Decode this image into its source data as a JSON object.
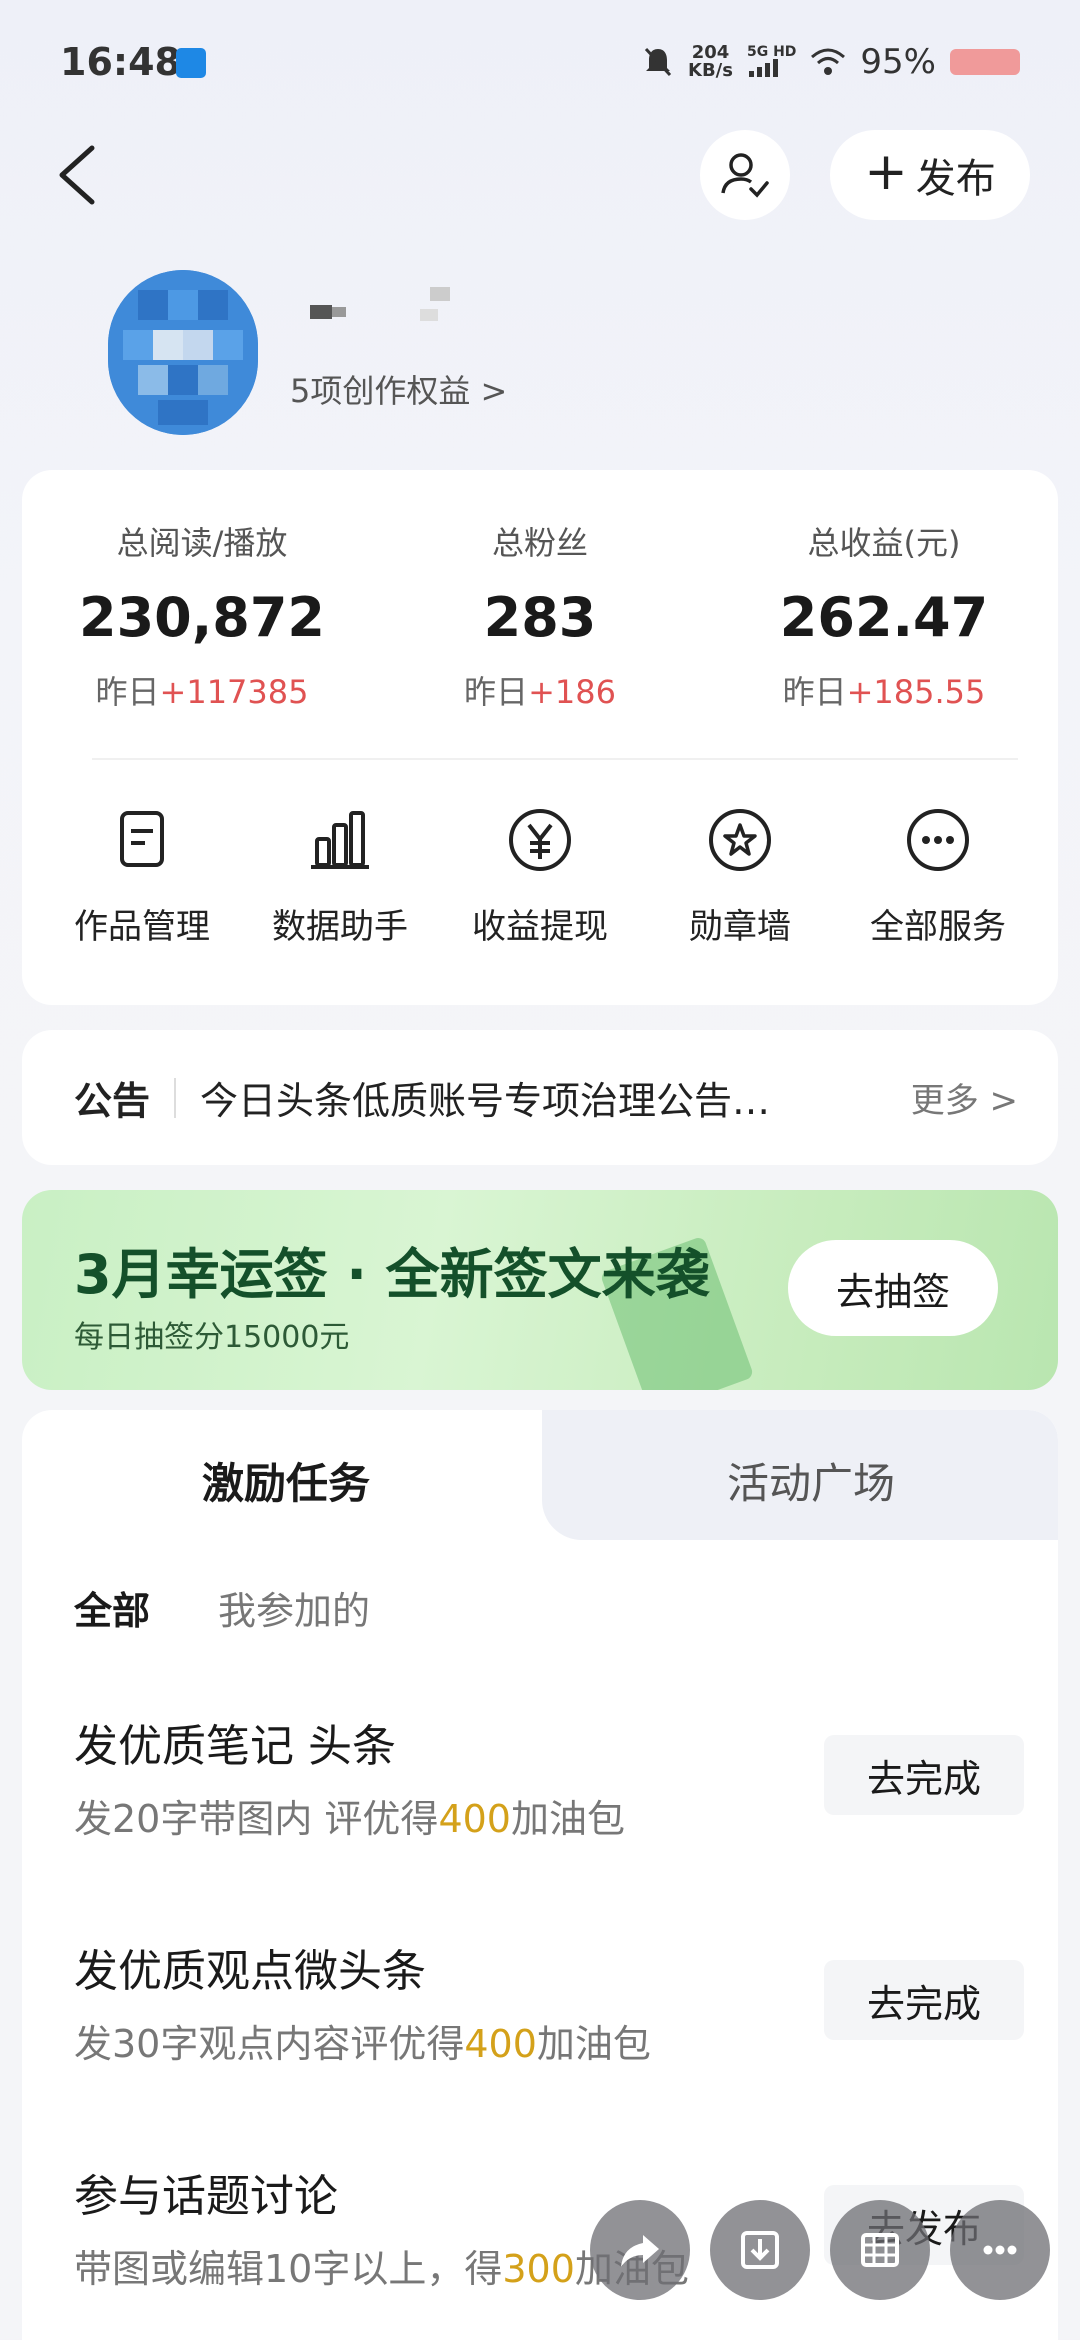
{
  "status_bar": {
    "time": "16:48",
    "net_speed_value": "204",
    "net_speed_unit": "KB/s",
    "network": "5G HD",
    "battery": "95%"
  },
  "header": {
    "publish_label": "发布",
    "follow_icon": "user-check-icon",
    "back_icon": "chevron-left-icon"
  },
  "profile": {
    "benefits_label": "5项创作权益 >"
  },
  "stats": [
    {
      "label": "总阅读/播放",
      "value": "230,872",
      "delta_prefix": "昨日",
      "delta": "+117385"
    },
    {
      "label": "总粉丝",
      "value": "283",
      "delta_prefix": "昨日",
      "delta": "+186"
    },
    {
      "label": "总收益(元)",
      "value": "262.47",
      "delta_prefix": "昨日",
      "delta": "+185.55"
    }
  ],
  "services": [
    {
      "label": "作品管理",
      "icon": "document-icon"
    },
    {
      "label": "数据助手",
      "icon": "bar-chart-icon"
    },
    {
      "label": "收益提现",
      "icon": "yuan-icon"
    },
    {
      "label": "勋章墙",
      "icon": "medal-icon"
    },
    {
      "label": "全部服务",
      "icon": "more-dots-icon"
    }
  ],
  "notice": {
    "title": "公告",
    "text": "今日头条低质账号专项治理公告…",
    "more": "更多 >"
  },
  "banner": {
    "title": "3月幸运签 · 全新签文来袭",
    "subtitle": "每日抽签分15000元",
    "button": "去抽签"
  },
  "tasks_section": {
    "tabs": [
      "激励任务",
      "活动广场"
    ],
    "filters": [
      "全部",
      "我参加的"
    ],
    "items": [
      {
        "title": "发优质笔记 头条",
        "desc_before": "发20字带图内 评优得",
        "reward": "400",
        "desc_after": "加油包",
        "button": "去完成"
      },
      {
        "title": "发优质观点微头条",
        "desc_before": "发30字观点内容评优得",
        "reward": "400",
        "desc_after": "加油包",
        "button": "去完成"
      },
      {
        "title": "参与话题讨论",
        "desc_before": "带图或编辑10字以上，得",
        "reward": "300",
        "desc_after": "加油包",
        "button": "去发布"
      }
    ]
  },
  "colors": {
    "accent_red": "#e05252",
    "reward_gold": "#d4a11a",
    "banner_green": "#14502a"
  }
}
